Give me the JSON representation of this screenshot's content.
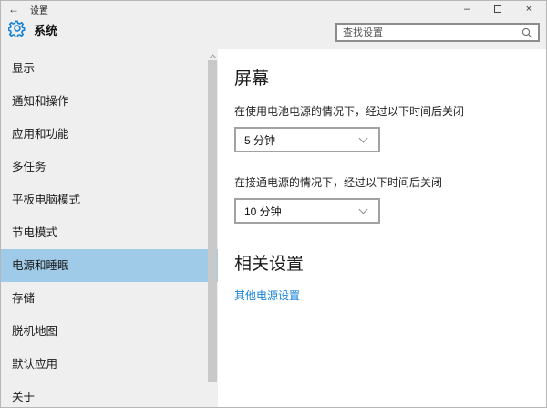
{
  "window": {
    "title": "设置",
    "icons": {
      "back": "←",
      "minimize": "–",
      "close": "×"
    }
  },
  "header": {
    "page_title": "系统",
    "search_placeholder": "查找设置",
    "search_value": ""
  },
  "sidebar": {
    "items": [
      {
        "label": "显示",
        "selected": false
      },
      {
        "label": "通知和操作",
        "selected": false
      },
      {
        "label": "应用和功能",
        "selected": false
      },
      {
        "label": "多任务",
        "selected": false
      },
      {
        "label": "平板电脑模式",
        "selected": false
      },
      {
        "label": "节电模式",
        "selected": false
      },
      {
        "label": "电源和睡眠",
        "selected": true
      },
      {
        "label": "存储",
        "selected": false
      },
      {
        "label": "脱机地图",
        "selected": false
      },
      {
        "label": "默认应用",
        "selected": false
      },
      {
        "label": "关于",
        "selected": false
      }
    ]
  },
  "content": {
    "screen_heading": "屏幕",
    "battery_label": "在使用电池电源的情况下，经过以下时间后关闭",
    "battery_value": "5 分钟",
    "plugged_label": "在接通电源的情况下，经过以下时间后关闭",
    "plugged_value": "10 分钟",
    "related_heading": "相关设置",
    "related_link": "其他电源设置"
  },
  "colors": {
    "accent": "#0078d7",
    "selected_item_bg": "#9fcbe9",
    "link": "#1583d9",
    "chrome_bg": "#efefef",
    "content_bg": "#ffffff"
  }
}
